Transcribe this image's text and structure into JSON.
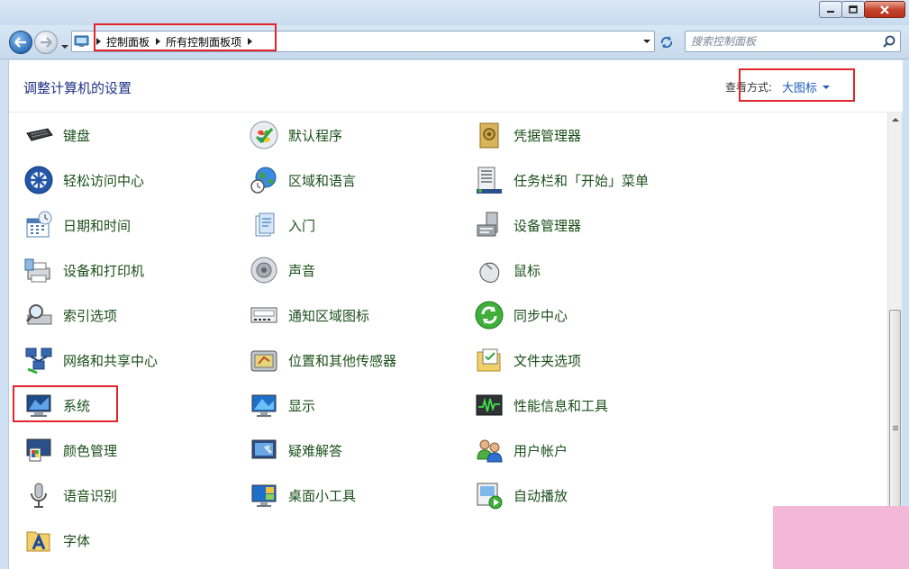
{
  "address_bar": {
    "breadcrumbs": [
      "控制面板",
      "所有控制面板项"
    ]
  },
  "search": {
    "placeholder": "搜索控制面板"
  },
  "header": {
    "title": "调整计算机的设置",
    "view_by_label": "查看方式:",
    "view_by_value": "大图标"
  },
  "items": [
    {
      "label": "键盘",
      "icon": "keyboard-icon"
    },
    {
      "label": "默认程序",
      "icon": "default-programs-icon"
    },
    {
      "label": "凭据管理器",
      "icon": "credential-manager-icon"
    },
    {
      "label": "轻松访问中心",
      "icon": "ease-of-access-icon"
    },
    {
      "label": "区域和语言",
      "icon": "region-language-icon"
    },
    {
      "label": "任务栏和「开始」菜单",
      "icon": "taskbar-start-menu-icon"
    },
    {
      "label": "日期和时间",
      "icon": "date-time-icon"
    },
    {
      "label": "入门",
      "icon": "getting-started-icon"
    },
    {
      "label": "设备管理器",
      "icon": "device-manager-icon"
    },
    {
      "label": "设备和打印机",
      "icon": "devices-printers-icon"
    },
    {
      "label": "声音",
      "icon": "sound-icon"
    },
    {
      "label": "鼠标",
      "icon": "mouse-icon"
    },
    {
      "label": "索引选项",
      "icon": "indexing-options-icon"
    },
    {
      "label": "通知区域图标",
      "icon": "notification-area-icon"
    },
    {
      "label": "同步中心",
      "icon": "sync-center-icon"
    },
    {
      "label": "网络和共享中心",
      "icon": "network-sharing-icon"
    },
    {
      "label": "位置和其他传感器",
      "icon": "location-sensors-icon"
    },
    {
      "label": "文件夹选项",
      "icon": "folder-options-icon"
    },
    {
      "label": "系统",
      "icon": "system-icon"
    },
    {
      "label": "显示",
      "icon": "display-icon"
    },
    {
      "label": "性能信息和工具",
      "icon": "performance-icon"
    },
    {
      "label": "颜色管理",
      "icon": "color-management-icon"
    },
    {
      "label": "疑难解答",
      "icon": "troubleshooting-icon"
    },
    {
      "label": "用户帐户",
      "icon": "user-accounts-icon"
    },
    {
      "label": "语音识别",
      "icon": "speech-recognition-icon"
    },
    {
      "label": "桌面小工具",
      "icon": "desktop-gadgets-icon"
    },
    {
      "label": "自动播放",
      "icon": "autoplay-icon"
    },
    {
      "label": "字体",
      "icon": "fonts-icon"
    }
  ],
  "colors": {
    "title_blue": "#1e3287",
    "link_green": "#1b4f1b",
    "annotation_red": "#e0262b"
  }
}
